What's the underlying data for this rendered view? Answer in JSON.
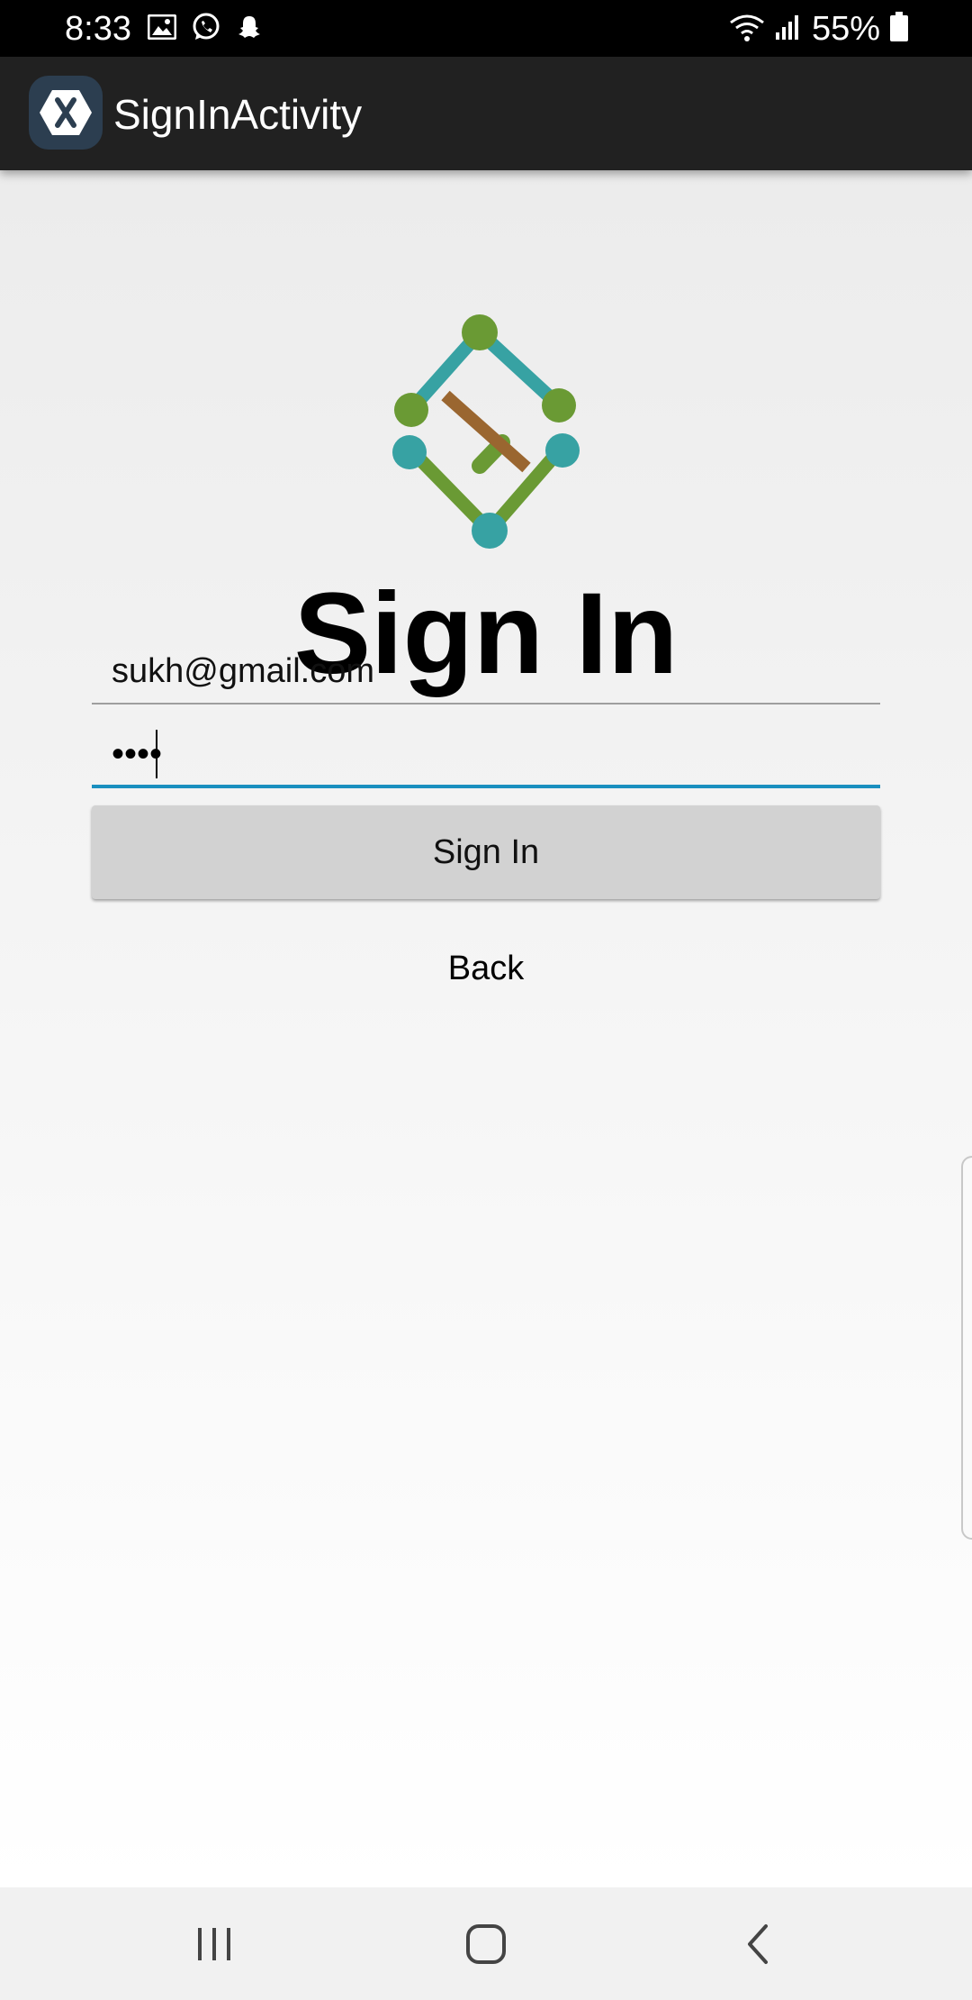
{
  "status_bar": {
    "time": "8:33",
    "battery_percent": "55%",
    "notification_icons": [
      "image-icon",
      "whatsapp-icon",
      "snapchat-icon"
    ],
    "system_icons": [
      "wifi-icon",
      "signal-icon",
      "battery-icon"
    ]
  },
  "app_bar": {
    "title": "SignInActivity",
    "logo_letter": "X"
  },
  "main": {
    "title": "Sign In",
    "email_value": "sukh@gmail.com",
    "password_value": "••••",
    "signin_label": "Sign In",
    "back_label": "Back"
  },
  "nav_bar": {
    "items": [
      "recent-apps-icon",
      "home-icon",
      "back-icon"
    ]
  },
  "colors": {
    "accent": "#1a8fbf",
    "logo_green": "#6a9a34",
    "logo_teal": "#37a2a3",
    "logo_brown": "#9a6630",
    "app_bar": "#212121"
  }
}
